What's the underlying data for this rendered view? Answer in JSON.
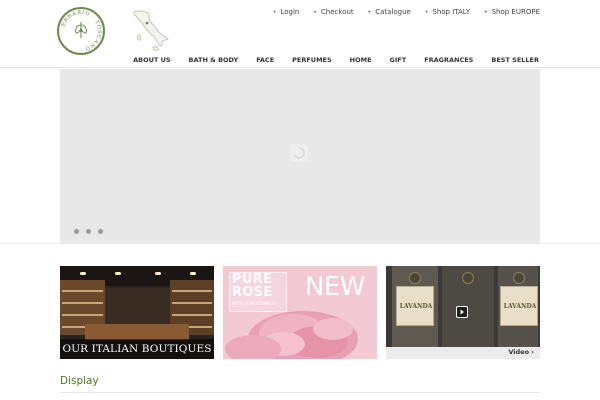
{
  "header": {
    "logo_text": "ERBARIO TOSCANO",
    "top_links": [
      {
        "label": "Login",
        "icon": "bullet-icon"
      },
      {
        "label": "Checkout",
        "icon": "bullet-icon"
      },
      {
        "label": "Catalogue",
        "icon": "bullet-icon"
      },
      {
        "label": "Shop ITALY",
        "icon": "bullet-icon"
      },
      {
        "label": "Shop EUROPE",
        "icon": "bullet-icon"
      }
    ],
    "main_nav": [
      "ABOUT US",
      "BATH & BODY",
      "FACE",
      "PERFUMES",
      "HOME",
      "GIFT",
      "FRAGRANCES",
      "BEST SELLER"
    ],
    "map_icon": "italy-map-icon"
  },
  "slider": {
    "loading_icon": "loading-spinner-icon",
    "dots": 3
  },
  "banners": {
    "boutiques_caption": "OUR ITALIAN BOUTIQUES",
    "pure": "PURE",
    "rose": "ROSE",
    "rose_sub": "WITH 3X BIOCOMPLEX",
    "new_label": "NEW",
    "bottle_labels": [
      "LAVANDA",
      "LAVANDA"
    ],
    "video_label": "Video ›"
  },
  "section": {
    "display_title": "Display"
  },
  "colors": {
    "accent_green": "#4c7a1e",
    "logo_green": "#6f8a4a",
    "slider_bg": "#e8e8e8"
  }
}
